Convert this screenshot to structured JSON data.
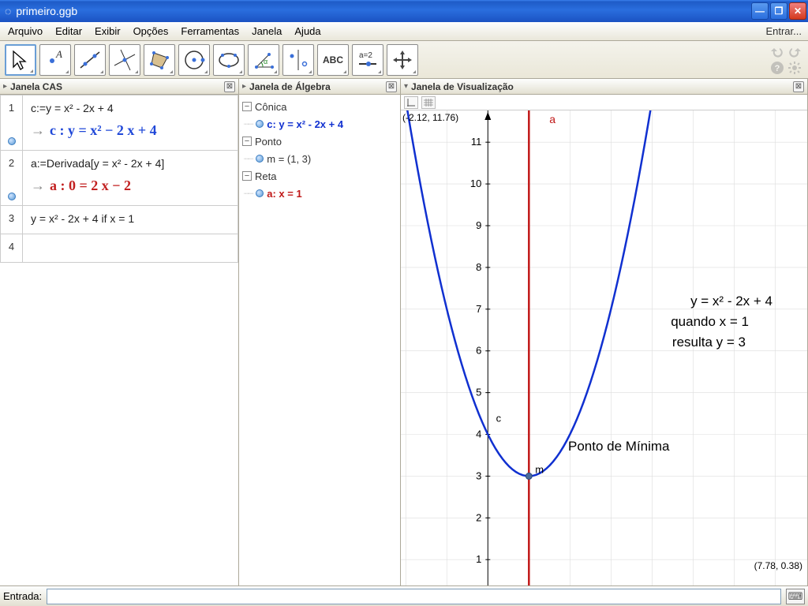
{
  "window": {
    "title": "primeiro.ggb"
  },
  "menu": {
    "items": [
      "Arquivo",
      "Editar",
      "Exibir",
      "Opções",
      "Ferramentas",
      "Janela",
      "Ajuda"
    ],
    "login": "Entrar..."
  },
  "toolbar": {
    "tools": [
      {
        "name": "move",
        "glyph": "cursor"
      },
      {
        "name": "point",
        "glyph": "point"
      },
      {
        "name": "line",
        "glyph": "line"
      },
      {
        "name": "perpendicular",
        "glyph": "perp"
      },
      {
        "name": "polygon",
        "glyph": "poly"
      },
      {
        "name": "circle",
        "glyph": "circle"
      },
      {
        "name": "conic",
        "glyph": "conic"
      },
      {
        "name": "angle",
        "glyph": "angle"
      },
      {
        "name": "reflect",
        "glyph": "reflect"
      },
      {
        "name": "text",
        "glyph": "ABC"
      },
      {
        "name": "slider",
        "glyph": "a=2"
      },
      {
        "name": "movegraphics",
        "glyph": "cross"
      }
    ]
  },
  "panels": {
    "cas": {
      "title": "Janela CAS"
    },
    "algebra": {
      "title": "Janela de Álgebra"
    },
    "graphics": {
      "title": "Janela de Visualização"
    }
  },
  "cas_rows": [
    {
      "n": "1",
      "in": "c:=y = x² - 2x + 4",
      "out_label": "c : ",
      "out": "y = x² − 2 x + 4",
      "out_style": "blue",
      "has_dot": true
    },
    {
      "n": "2",
      "in": "a:=Derivada[y = x² - 2x + 4]",
      "out_label": "a : ",
      "out": "0 = 2 x − 2",
      "out_style": "red",
      "has_dot": true
    },
    {
      "n": "3",
      "in": "y = x² - 2x + 4 if x = 1",
      "out": "",
      "out_label": "",
      "out_style": "",
      "has_dot": false
    },
    {
      "n": "4",
      "in": "",
      "out": "",
      "out_label": "",
      "out_style": "",
      "has_dot": false
    }
  ],
  "algebra_tree": {
    "groups": [
      {
        "label": "Cônica",
        "children": [
          {
            "text": "c: y = x² - 2x + 4",
            "style": "blue-b"
          }
        ]
      },
      {
        "label": "Ponto",
        "children": [
          {
            "text": "m = (1, 3)",
            "style": ""
          }
        ]
      },
      {
        "label": "Reta",
        "children": [
          {
            "text": "a: x = 1",
            "style": "red-b"
          }
        ]
      }
    ]
  },
  "graphics": {
    "coord_tl": "(-2.12, 11.76)",
    "coord_br": "(7.78, 0.38)",
    "y_ticks": [
      "1",
      "2",
      "3",
      "4",
      "5",
      "6",
      "7",
      "8",
      "9",
      "10",
      "11"
    ],
    "labels": {
      "curve": "c",
      "line": "a",
      "point": "m"
    },
    "annotations": {
      "eq1": "y = x² - 2x + 4",
      "eq2": "quando x = 1",
      "eq3": "resulta y = 3",
      "min": "Ponto de Mínima"
    }
  },
  "chart_data": {
    "type": "line",
    "title": "",
    "xlabel": "",
    "ylabel": "",
    "xlim": [
      -2.12,
      7.78
    ],
    "ylim": [
      0.38,
      11.76
    ],
    "series": [
      {
        "name": "c: y = x² - 2x + 4",
        "kind": "parabola",
        "expr": "y = x^2 - 2x + 4",
        "color": "#1030d0"
      },
      {
        "name": "a: x = 1",
        "kind": "vertical_line",
        "x": 1,
        "color": "#c01818"
      }
    ],
    "points": [
      {
        "name": "m",
        "x": 1,
        "y": 3
      }
    ],
    "annotations": [
      {
        "text": "y = x² - 2x + 4",
        "x": 5.5,
        "y": 8.5
      },
      {
        "text": "quando x = 1",
        "x": 5.5,
        "y": 7.9
      },
      {
        "text": "resulta y = 3",
        "x": 5.5,
        "y": 7.3
      },
      {
        "text": "Ponto de Mínima",
        "x": 4.0,
        "y": 3.0
      }
    ]
  },
  "inputbar": {
    "label": "Entrada:",
    "value": ""
  }
}
